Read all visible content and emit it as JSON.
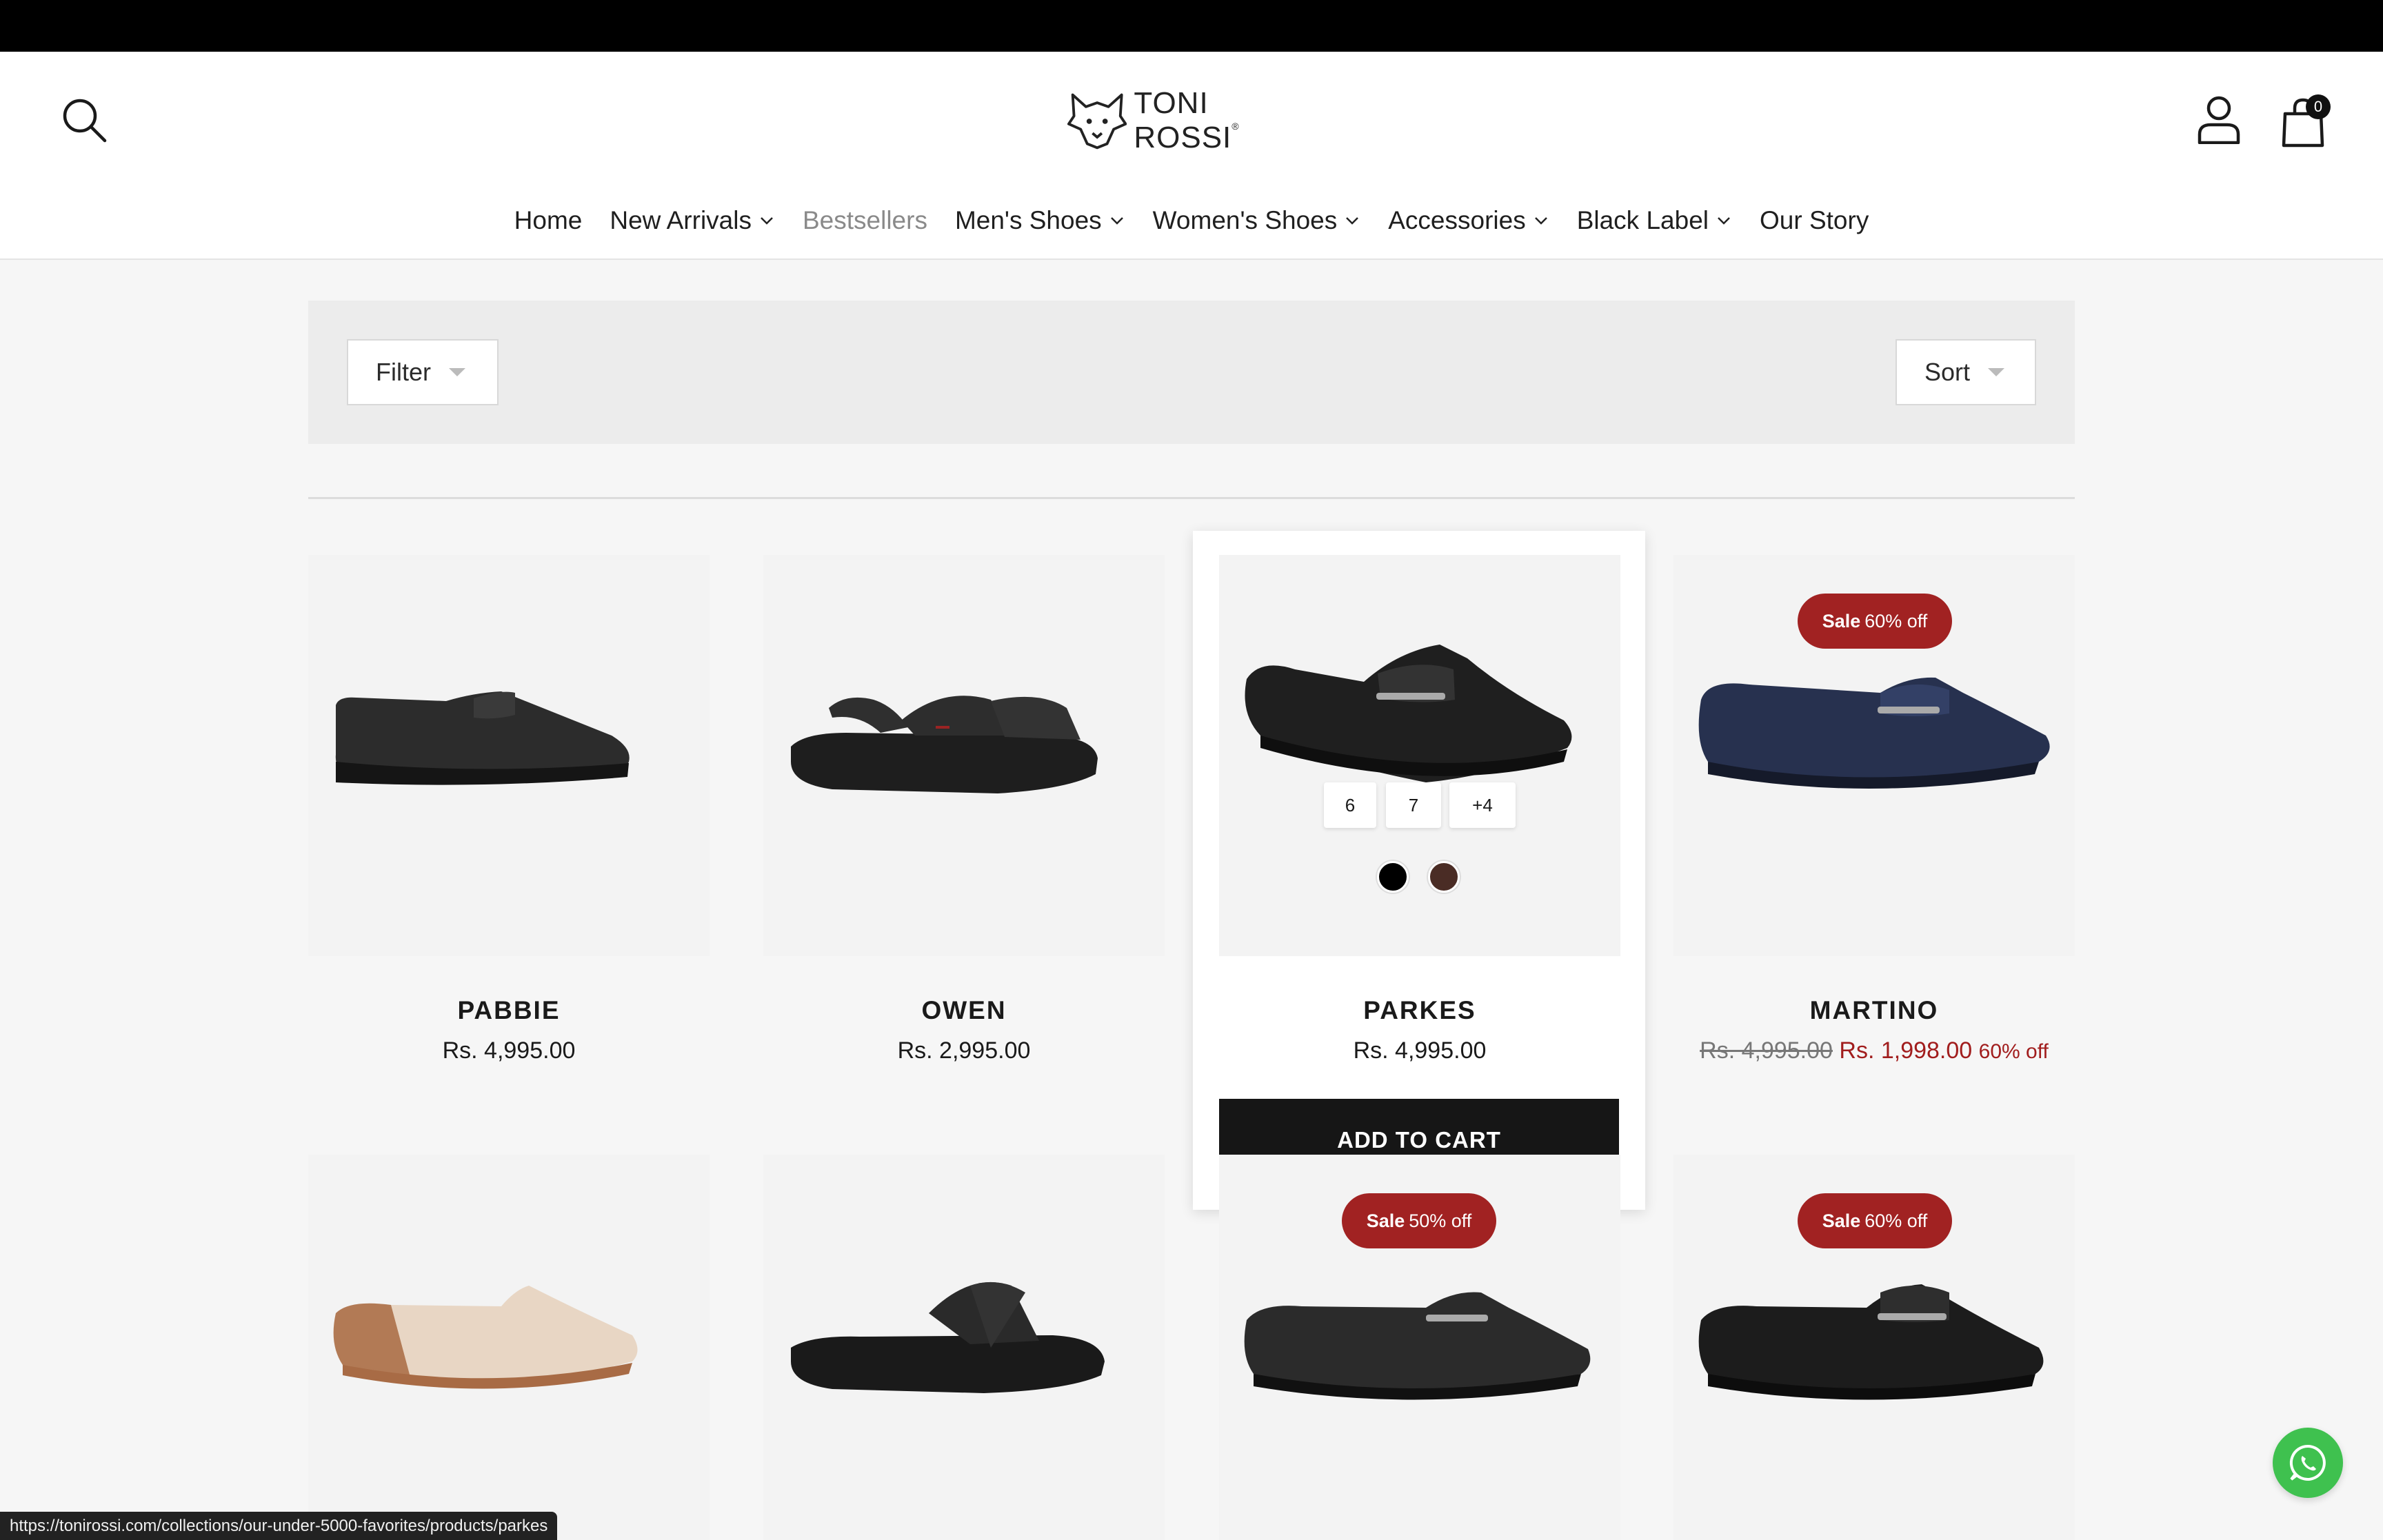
{
  "header": {
    "logo_text": "TONI ROSSI",
    "logo_mark": "®",
    "cart_count": "0"
  },
  "nav": {
    "items": [
      {
        "label": "Home"
      },
      {
        "label": "New Arrivals"
      },
      {
        "label": "Bestsellers"
      },
      {
        "label": "Men's Shoes"
      },
      {
        "label": "Women's Shoes"
      },
      {
        "label": "Accessories"
      },
      {
        "label": "Black Label"
      },
      {
        "label": "Our Story"
      }
    ]
  },
  "toolbar": {
    "filter_label": "Filter",
    "sort_label": "Sort"
  },
  "products": [
    {
      "name": "PABBIE",
      "price": "Rs. 4,995.00"
    },
    {
      "name": "OWEN",
      "price": "Rs. 2,995.00"
    },
    {
      "name": "PARKES",
      "price": "Rs. 4,995.00",
      "sizes": [
        "6",
        "7",
        "+4"
      ],
      "swatches": [
        "#000000",
        "#4a2c25"
      ],
      "add_to_cart": "ADD TO CART"
    },
    {
      "name": "MARTINO",
      "compare_price": "Rs. 4,995.00",
      "sale_price": "Rs. 1,998.00",
      "discount": "60% off",
      "badge_bold": "Sale",
      "badge_text": "60% off"
    }
  ],
  "row2_badges": [
    {
      "bold": "Sale",
      "text": "50% off"
    },
    {
      "bold": "Sale",
      "text": "60% off"
    }
  ],
  "status_url": "https://tonirossi.com/collections/our-under-5000-favorites/products/parkes",
  "colors": {
    "sale": "#a12222",
    "whatsapp": "#3fc14f",
    "button": "#161616"
  }
}
